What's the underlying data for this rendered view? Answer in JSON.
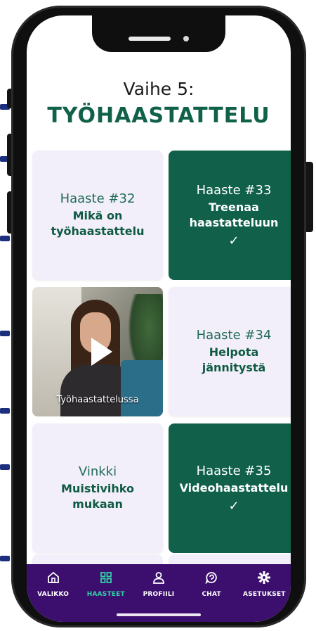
{
  "page": {
    "step": "Vaihe 5:",
    "title": "TYÖHAASTATTELU"
  },
  "cards": [
    {
      "num": "Haaste #32",
      "name": "Mikä on työhaastattelu",
      "style": "light",
      "done": false
    },
    {
      "num": "Haaste #33",
      "name": "Treenaa haastatteluun",
      "style": "dark",
      "done": true
    },
    {
      "video_caption": "Työhaastattelussa",
      "style": "video"
    },
    {
      "num": "Haaste #34",
      "name": "Helpota jännitystä",
      "style": "light",
      "done": false
    },
    {
      "num": "Vinkki",
      "name": "Muistivihko mukaan",
      "style": "light",
      "done": false
    },
    {
      "num": "Haaste #35",
      "name": "Videohaastattelu",
      "style": "dark",
      "done": true
    }
  ],
  "check_mark": "✓",
  "nav": {
    "items": [
      {
        "label": "VALIKKO",
        "icon": "home-icon",
        "active": false
      },
      {
        "label": "HAASTEET",
        "icon": "grid-icon",
        "active": true
      },
      {
        "label": "PROFIILI",
        "icon": "user-icon",
        "active": false
      },
      {
        "label": "CHAT",
        "icon": "chat-icon",
        "active": false
      },
      {
        "label": "ASETUKSET",
        "icon": "gear-icon",
        "active": false
      }
    ]
  },
  "colors": {
    "brand_green": "#11614a",
    "card_light": "#f3effa",
    "nav_bg": "#3c0f6e",
    "nav_active": "#2fd3a6"
  }
}
